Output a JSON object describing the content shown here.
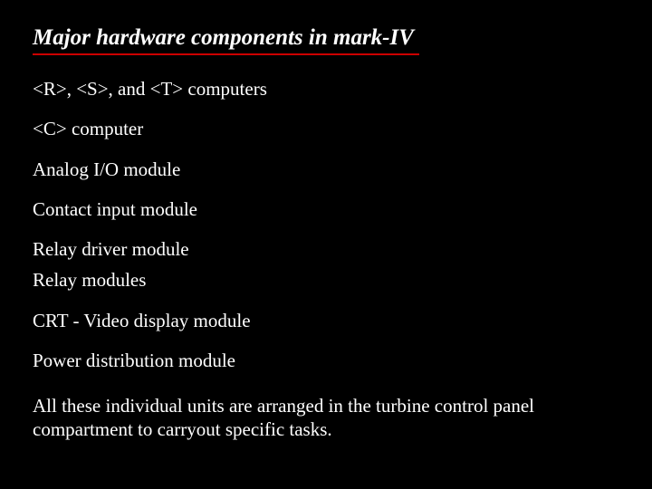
{
  "title": "Major hardware components in mark-IV",
  "items": [
    "<R>, <S>, and <T> computers",
    "<C> computer",
    "Analog I/O module",
    "Contact input module",
    "Relay driver module",
    "Relay modules",
    "CRT - Video display module",
    "Power distribution module"
  ],
  "summary": "All these individual units are arranged in the turbine control panel compartment to carryout specific tasks."
}
